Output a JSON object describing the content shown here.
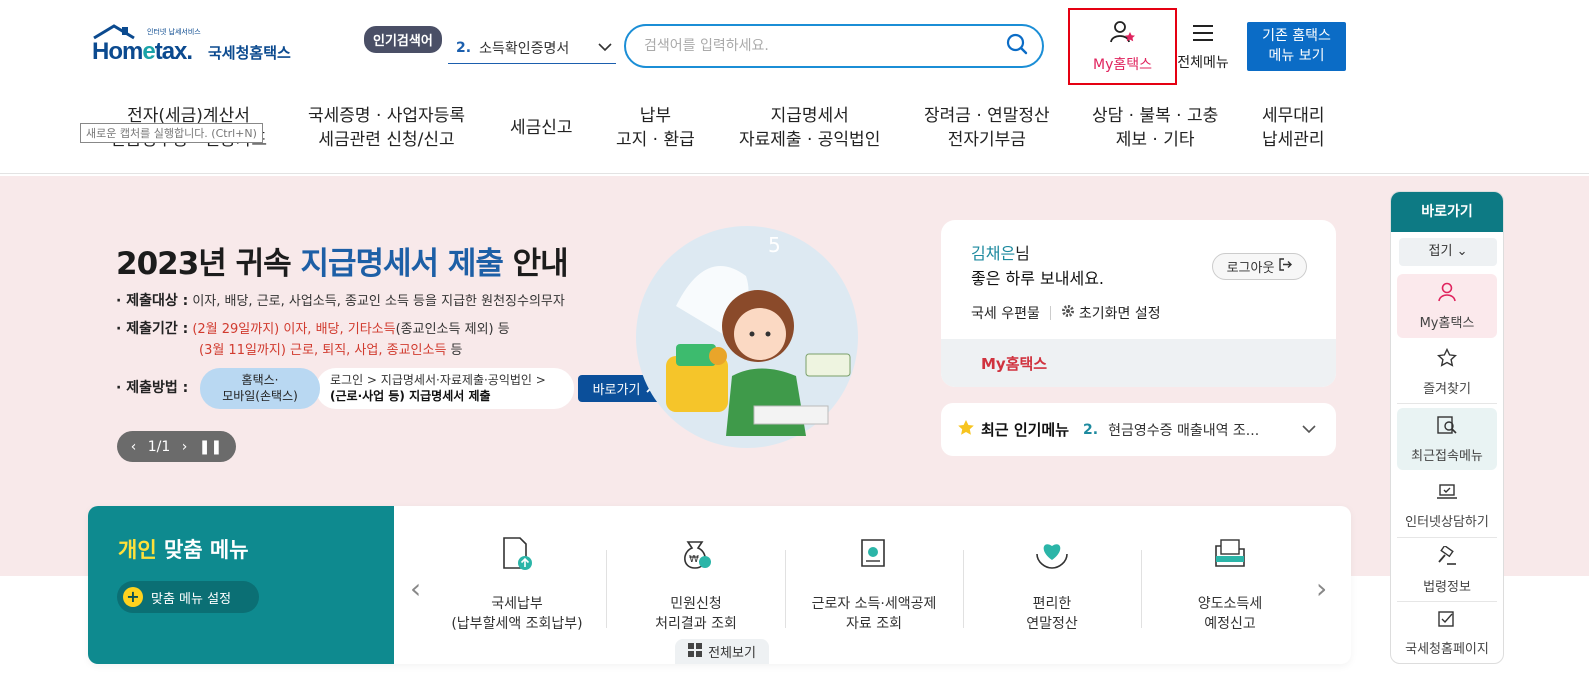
{
  "header": {
    "logo_small": "인터넷 납세서비스",
    "logo_word_a": "Hom",
    "logo_word_e": "e",
    "logo_word_b": "tax.",
    "logo_kr": "국세청홈택스",
    "hot_tag": "인기검색어",
    "hot_num": "2.",
    "hot_value": "소득확인증명서",
    "search_placeholder": "검색어를 입력하세요.",
    "my_hometax": "My홈택스",
    "all_menu": "전체메뉴",
    "classic_line1": "기존 홈택스",
    "classic_line2": "메뉴 보기"
  },
  "nav": [
    {
      "l1": "전자(세금)계산서",
      "l2": "현금영수증 · 신용카드"
    },
    {
      "l1": "국세증명 · 사업자등록",
      "l2": "세금관련 신청/신고"
    },
    {
      "l1": "세금신고",
      "l2": ""
    },
    {
      "l1": "납부",
      "l2": "고지 · 환급"
    },
    {
      "l1": "지급명세서",
      "l2": "자료제출 · 공익법인"
    },
    {
      "l1": "장려금 · 연말정산",
      "l2": "전자기부금"
    },
    {
      "l1": "상담 · 불복 · 고충",
      "l2": "제보 · 기타"
    },
    {
      "l1": "세무대리",
      "l2": "납세관리"
    }
  ],
  "tooltip": "새로운 캡처를 실행합니다. (Ctrl+N)",
  "banner": {
    "title_a": "2023년 귀속 ",
    "title_hl": "지급명세서 제출",
    "title_b": " 안내",
    "target_key": "· 제출대상 :",
    "target_val": "이자, 배당, 근로, 사업소득, 종교인 소득 등을 지급한 원천징수의무자",
    "period_key": "· 제출기간 :",
    "period1_red": "(2월 29일까지) 이자, 배당, 기타소득",
    "period1_rest": "(종교인소득 제외) 등",
    "period2_red": "(3월 11일까지) 근로, 퇴직, 사업, 종교인소득",
    "period2_rest": " 등",
    "method_key": "· 제출방법 :",
    "method_pill_1": "홈택스·",
    "method_pill_2": "모바일(손택스)",
    "method_desc_1": "로그인 > 지급명세서·자료제출·공익법인 >",
    "method_desc_2": "(근로·사업 등) 지급명세서 제출",
    "goto": "바로가기",
    "pager": "1/1"
  },
  "login_card": {
    "user": "김채은",
    "suffix": "님",
    "greeting": "좋은 하루 보내세요.",
    "logout": "로그아웃",
    "mail": "국세 우편물",
    "home_setting": "초기화면 설정",
    "my_hometax": "My홈택스"
  },
  "popular": {
    "title": "최근 인기메뉴",
    "num": "2.",
    "value": "현금영수증 매출내역 조..."
  },
  "quick": {
    "title": "바로가기",
    "fold": "접기",
    "items": [
      {
        "label": "My홈택스",
        "icon": "person-icon"
      },
      {
        "label": "즐겨찾기",
        "icon": "star-icon"
      },
      {
        "label": "최근접속메뉴",
        "icon": "recent-search-icon"
      },
      {
        "label": "인터넷상담하기",
        "icon": "laptop-check-icon"
      },
      {
        "label": "법령정보",
        "icon": "gavel-icon"
      },
      {
        "label": "국세청홈페이지",
        "icon": "edit-check-icon"
      }
    ]
  },
  "personal_menu": {
    "title_hl": "개인",
    "title_rest": " 맞춤 메뉴",
    "setting": "맞춤 메뉴 설정",
    "items": [
      {
        "l1": "국세납부",
        "l2": "(납부할세액 조회납부)"
      },
      {
        "l1": "민원신청",
        "l2": "처리결과 조회"
      },
      {
        "l1": "근로자 소득·세액공제",
        "l2": "자료 조회"
      },
      {
        "l1": "편리한",
        "l2": "연말정산"
      },
      {
        "l1": "양도소득세",
        "l2": "예정신고"
      }
    ],
    "view_all": "전체보기"
  },
  "colors": {
    "brand_blue": "#0b4a8f",
    "teal": "#0e8a8f",
    "banner_bg": "#f8e9ea",
    "highlight_red": "#e50012"
  }
}
